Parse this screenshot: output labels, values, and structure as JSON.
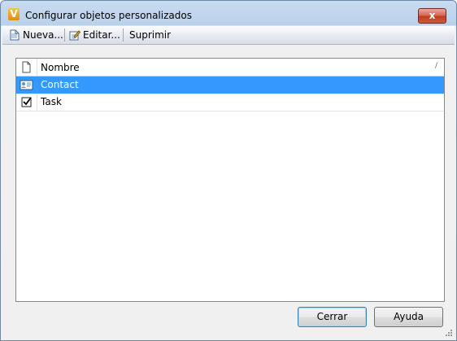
{
  "window": {
    "title": "Configurar objetos personalizados",
    "app_icon_letter": "V",
    "close_glyph": "x"
  },
  "toolbar": {
    "new_label": "Nueva...",
    "edit_label": "Editar...",
    "delete_label": "Suprimir"
  },
  "list": {
    "columns": [
      "Nombre"
    ],
    "rows": [
      {
        "name": "Contact",
        "icon": "contact-card-icon",
        "selected": true
      },
      {
        "name": "Task",
        "icon": "task-checkbox-icon",
        "selected": false
      }
    ]
  },
  "buttons": {
    "close_label": "Cerrar",
    "help_label": "Ayuda"
  },
  "colors": {
    "selection": "#3399ff",
    "close_button": "#c23b21"
  }
}
